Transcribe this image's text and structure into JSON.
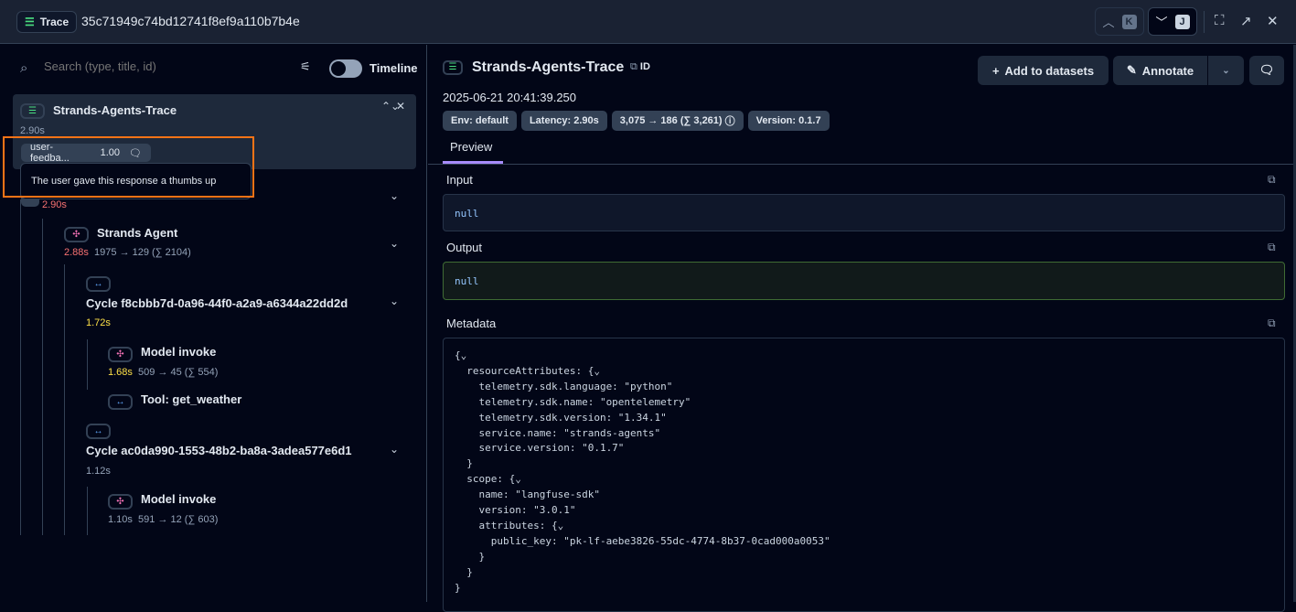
{
  "header": {
    "badge": "Trace",
    "trace_id": "35c71949c74bd12741f8ef9a110b7b4e",
    "prev_key": "K",
    "next_key": "J"
  },
  "left": {
    "search_placeholder": "Search (type, title, id)",
    "timeline_label": "Timeline",
    "timeline_on": false,
    "root": {
      "title": "Strands-Agents-Trace",
      "duration": "2.90s",
      "score_name": "user-feedba...",
      "score_value": "1.00",
      "tooltip": "The user gave this response a thumbs up"
    },
    "nodes": [
      {
        "title": "",
        "duration": "2.90s",
        "duration_color": "#f87171",
        "tokens": ""
      },
      {
        "title": "Strands Agent",
        "duration": "2.88s",
        "duration_color": "#f87171",
        "tokens": "1975 → 129 (∑ 2104)"
      },
      {
        "title": "Cycle f8cbbb7d-0a96-44f0-a2a9-a6344a22dd2d",
        "duration": "1.72s",
        "duration_color": "#fde047",
        "tokens": ""
      },
      {
        "title": "Model invoke",
        "duration": "1.68s",
        "duration_color": "#fde047",
        "tokens": "509 → 45 (∑ 554)"
      },
      {
        "title": "Tool: get_weather",
        "duration": "",
        "tokens": ""
      },
      {
        "title": "Cycle ac0da990-1553-48b2-ba8a-3adea577e6d1",
        "duration": "1.12s",
        "duration_color": "#94a3b8",
        "tokens": ""
      },
      {
        "title": "Model invoke",
        "duration": "1.10s",
        "duration_color": "#94a3b8",
        "tokens": "591 → 12 (∑ 603)"
      }
    ]
  },
  "right": {
    "title": "Strands-Agents-Trace",
    "id_label": "ID",
    "timestamp": "2025-06-21 20:41:39.250",
    "badges": [
      "Env: default",
      "Latency: 2.90s",
      "3,075 → 186 (∑ 3,261)",
      "Version: 0.1.7"
    ],
    "add_datasets": "Add to datasets",
    "annotate": "Annotate",
    "tab": "Preview",
    "input_label": "Input",
    "input_value": "null",
    "output_label": "Output",
    "output_value": "null",
    "metadata_label": "Metadata",
    "metadata": "{⌄\n  resourceAttributes: {⌄\n    telemetry.sdk.language: \"python\"\n    telemetry.sdk.name: \"opentelemetry\"\n    telemetry.sdk.version: \"1.34.1\"\n    service.name: \"strands-agents\"\n    service.version: \"0.1.7\"\n  }\n  scope: {⌄\n    name: \"langfuse-sdk\"\n    version: \"3.0.1\"\n    attributes: {⌄\n      public_key: \"pk-lf-aebe3826-55dc-4774-8b37-0cad000a0053\"\n    }\n  }\n}"
  },
  "colors": {
    "accent_tab": "#a78bfa",
    "highlight": "#f97316",
    "output_border": "#3f6b34"
  }
}
